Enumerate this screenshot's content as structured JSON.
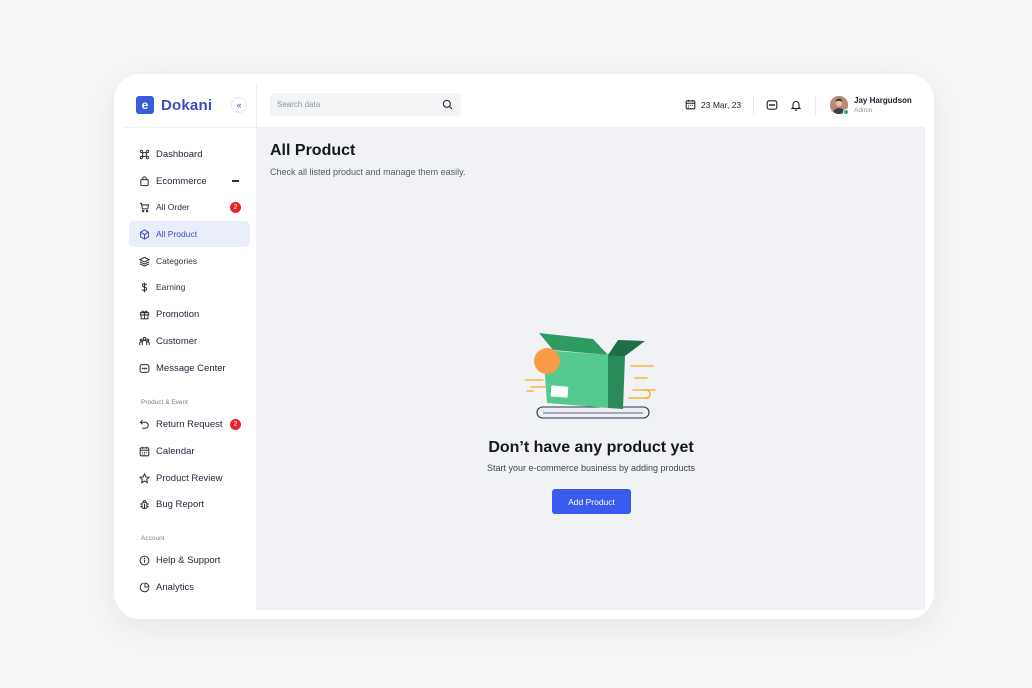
{
  "brand": {
    "logo_letter": "e",
    "name": "Dokani"
  },
  "sidebar": {
    "collapse_glyph": "«",
    "items": [
      {
        "label": "Dashboard"
      },
      {
        "label": "Ecommerce"
      },
      {
        "label": "All Order",
        "badge": "2"
      },
      {
        "label": "All Product"
      },
      {
        "label": "Categories"
      },
      {
        "label": "Earning"
      },
      {
        "label": "Promotion"
      },
      {
        "label": "Customer"
      },
      {
        "label": "Message Center"
      },
      {
        "label": "Return Request",
        "badge": "2"
      },
      {
        "label": "Calendar"
      },
      {
        "label": "Product Review"
      },
      {
        "label": "Bug Report"
      },
      {
        "label": "Help & Support"
      },
      {
        "label": "Analytics"
      }
    ],
    "sections": {
      "product_event": "Product & Event",
      "account": "Account"
    }
  },
  "header": {
    "search_placeholder": "Search data",
    "date": "23 Mar, 23",
    "user": {
      "name": "Jay Hargudson",
      "role": "Admin"
    }
  },
  "main": {
    "title": "All Product",
    "subtitle": "Check all listed product and manage them easily.",
    "empty_title": "Don’t have any product yet",
    "empty_subtitle": "Start your e-commerce business by adding products",
    "add_button": "Add Product"
  },
  "colors": {
    "accent": "#3b5bef",
    "brand": "#3b4cc0",
    "badge": "#e8242b",
    "box": "#4fc58e"
  }
}
